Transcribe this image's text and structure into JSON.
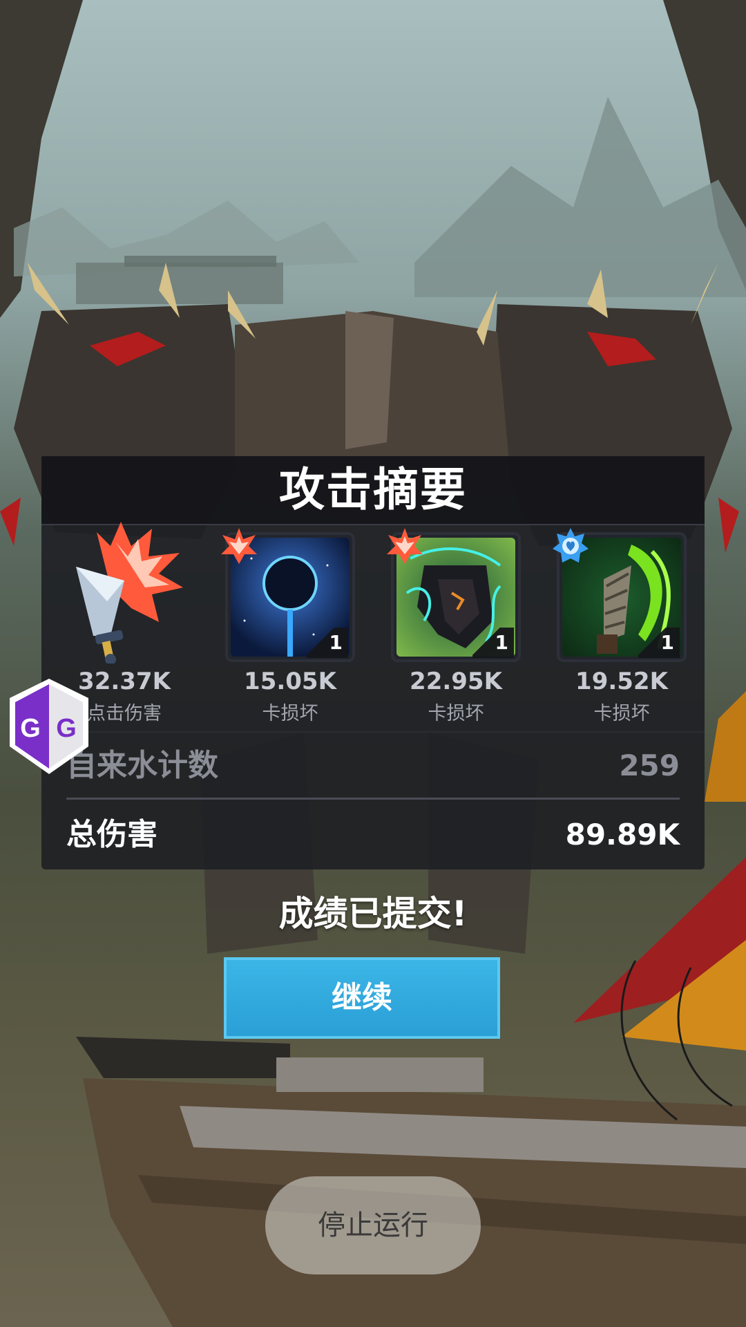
{
  "panel": {
    "title": "攻击摘要"
  },
  "cards": [
    {
      "icon": "tap-damage-sword-icon",
      "value": "32.37K",
      "label": "点击伤害",
      "count": ""
    },
    {
      "icon": "black-hole-card-icon",
      "value": "15.05K",
      "label": "卡损坏",
      "count": "1"
    },
    {
      "icon": "lightning-beast-card-icon",
      "value": "22.95K",
      "label": "卡损坏",
      "count": "1"
    },
    {
      "icon": "poison-blade-card-icon",
      "value": "19.52K",
      "label": "卡损坏",
      "count": "1"
    }
  ],
  "rows": {
    "fountain": {
      "label": "自来水计数",
      "value": "259"
    },
    "total": {
      "label": "总伤害",
      "value": "89.89K"
    }
  },
  "status": {
    "submitted": "成绩已提交!"
  },
  "buttons": {
    "continue": "继续",
    "stop": "停止运行"
  },
  "overlay": {
    "gg_label": "GG"
  },
  "colors": {
    "panel_bg": "#1e1f24",
    "continue_button": "#2a9fd6",
    "badge_damage": "#ff5a3c",
    "badge_support": "#3a9ff0"
  }
}
